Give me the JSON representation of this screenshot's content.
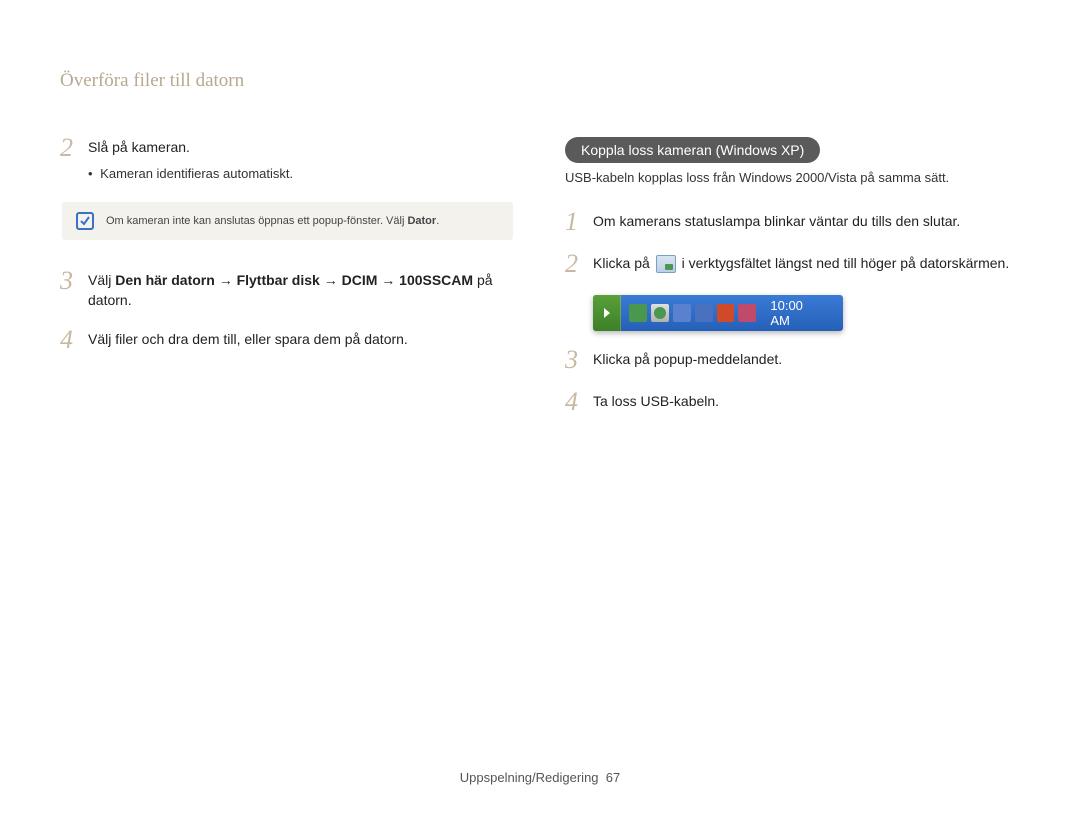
{
  "page_title": "Överföra filer till datorn",
  "left": {
    "step2": {
      "num": "2",
      "text": "Slå på kameran.",
      "bullet": "Kameran identifieras automatiskt."
    },
    "note": {
      "text_pre": "Om kameran inte kan anslutas öppnas ett popup-fönster. Välj ",
      "text_bold": "Dator",
      "text_post": "."
    },
    "step3": {
      "num": "3",
      "pre": "Välj ",
      "bold": "Den här datorn → Flyttbar disk → DCIM → 100SSCAM",
      "post": " på datorn."
    },
    "step4": {
      "num": "4",
      "text": "Välj filer och dra dem till, eller spara dem på datorn."
    }
  },
  "right": {
    "pill": "Koppla loss kameran (Windows XP)",
    "subtitle": "USB-kabeln kopplas loss från Windows 2000/Vista på samma sätt.",
    "step1": {
      "num": "1",
      "text": "Om kamerans statuslampa blinkar väntar du tills den slutar."
    },
    "step2": {
      "num": "2",
      "text_pre": "Klicka på ",
      "text_post": " i verktygsfältet längst ned till höger på datorskärmen."
    },
    "taskbar_time": "10:00 AM",
    "step3": {
      "num": "3",
      "text": "Klicka på popup-meddelandet."
    },
    "step4": {
      "num": "4",
      "text": "Ta loss USB-kabeln."
    }
  },
  "footer": {
    "section": "Uppspelning/Redigering",
    "page": "67"
  }
}
